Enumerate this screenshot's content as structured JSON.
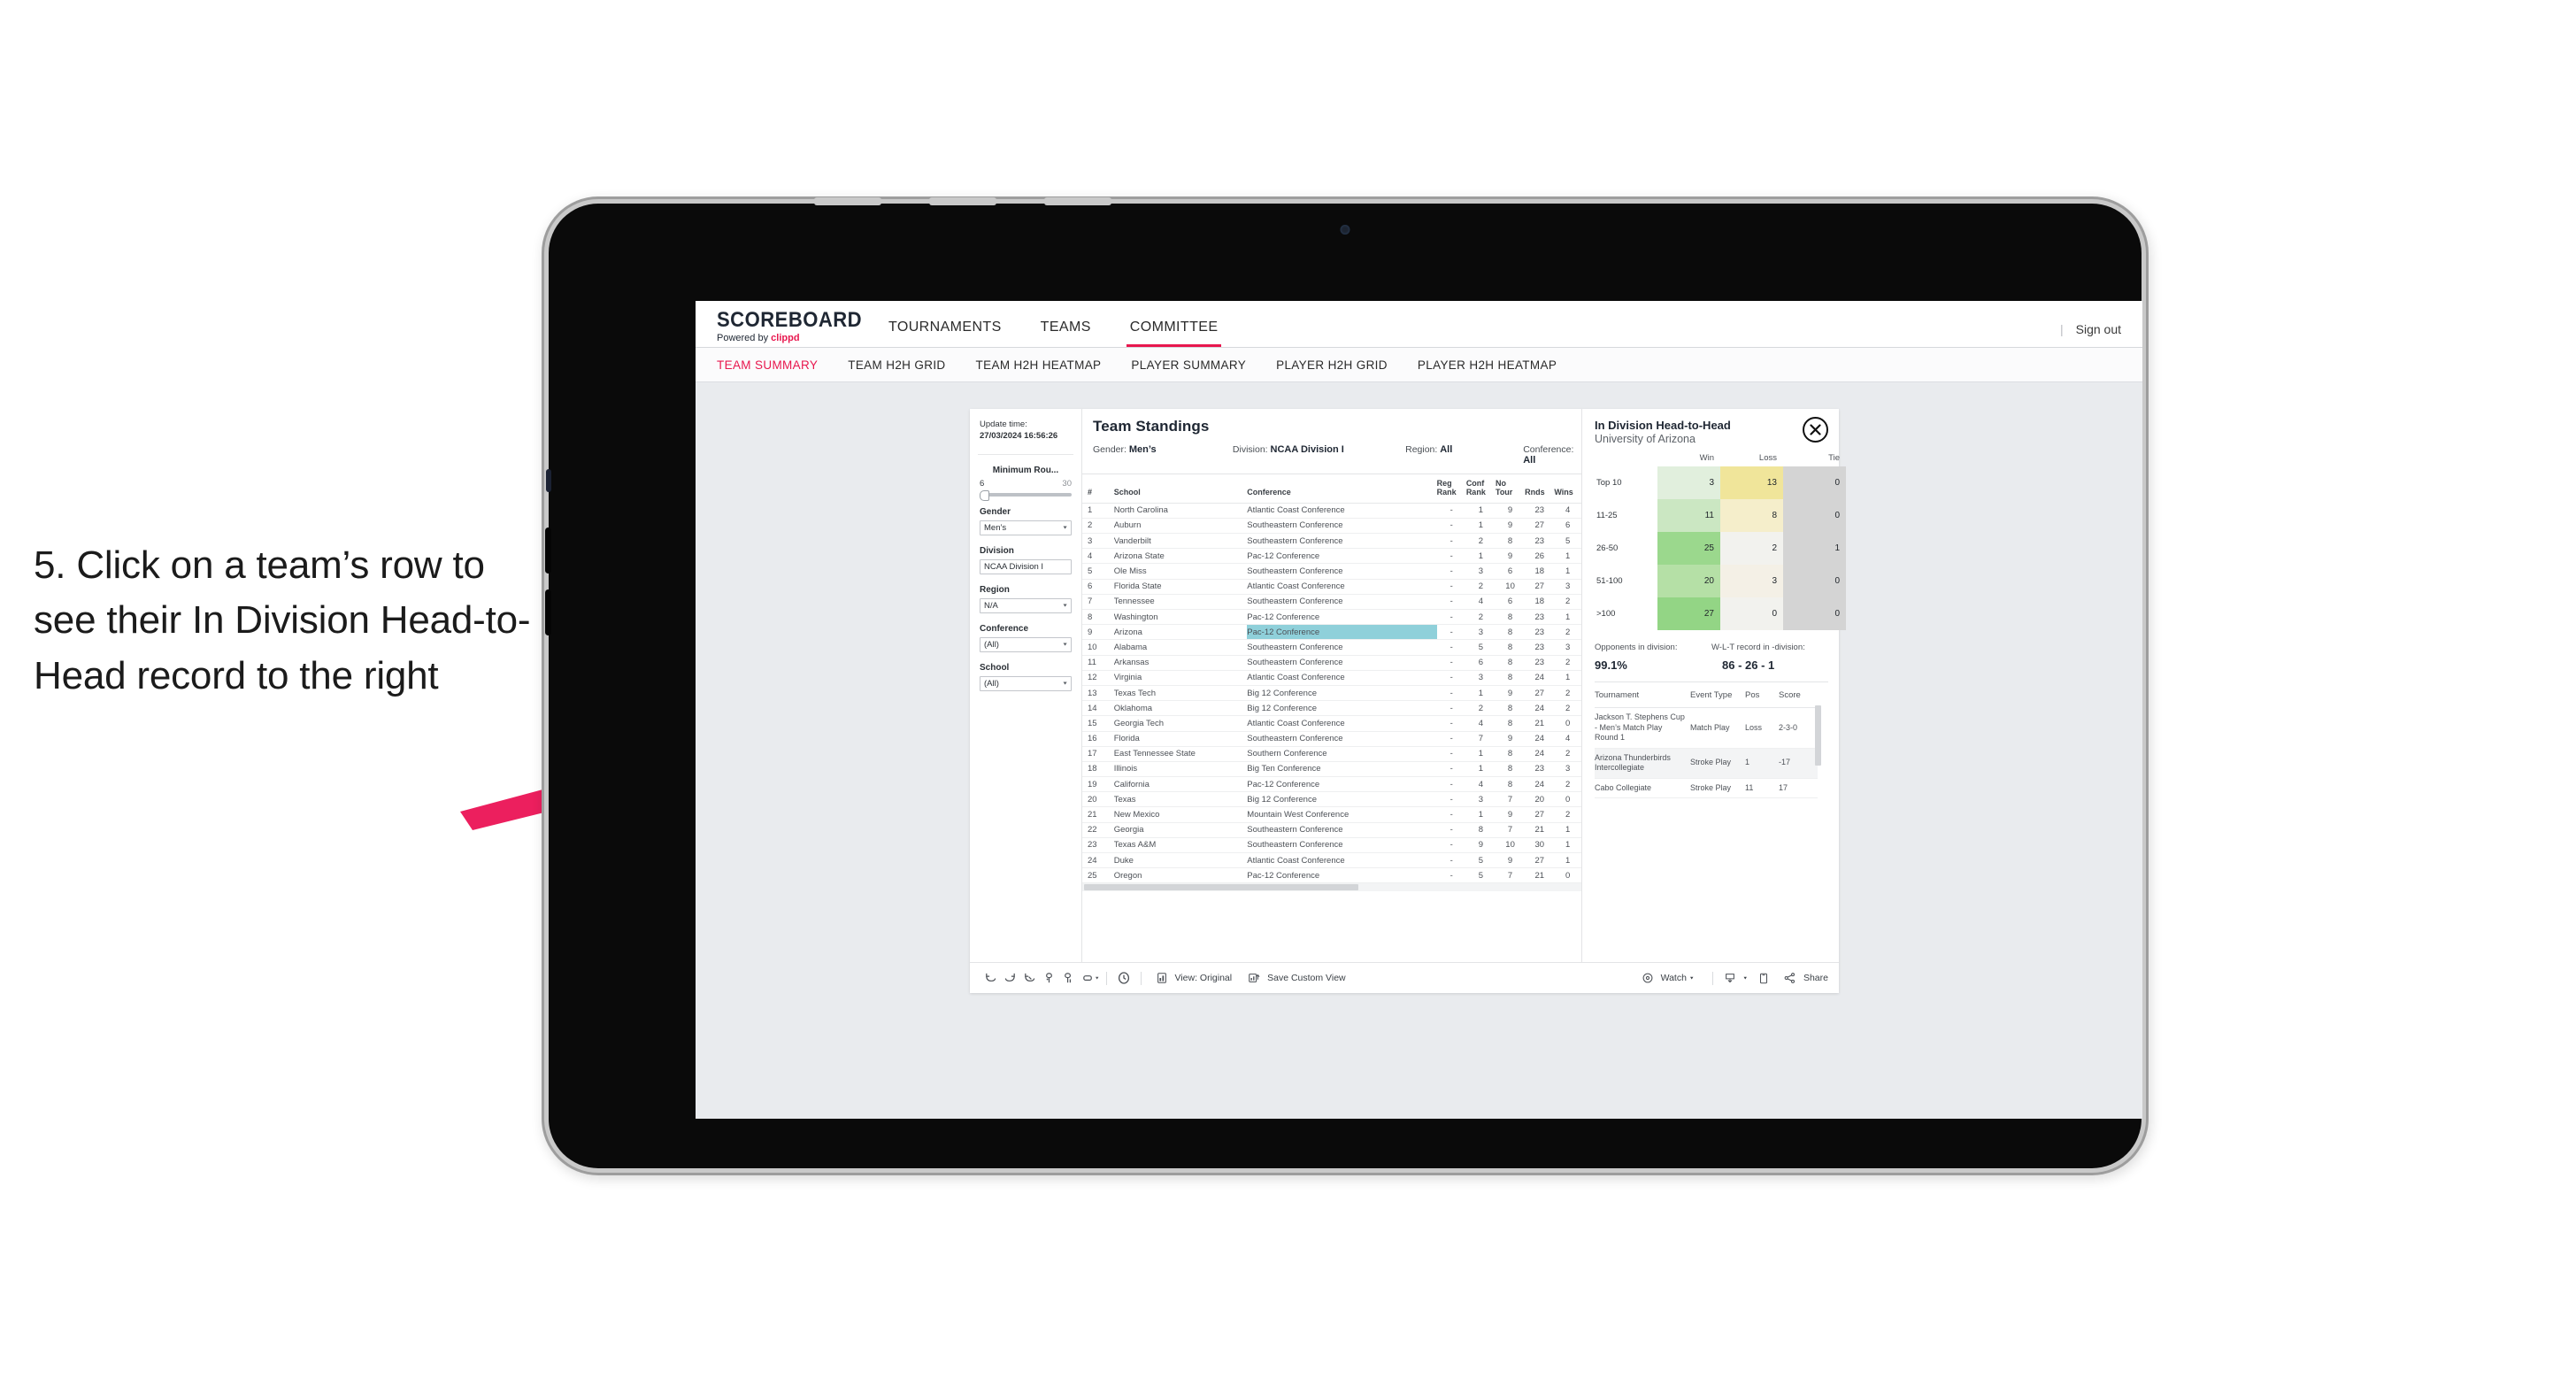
{
  "annotation": {
    "text": "5. Click on a team’s row to see their In Division Head-to-Head record to the right",
    "color": "#ec1f5e"
  },
  "app": {
    "brand": {
      "name": "SCOREBOARD",
      "powered_prefix": "Powered by ",
      "powered_brand": "clippd"
    },
    "top_nav": [
      {
        "label": "TOURNAMENTS",
        "active": false
      },
      {
        "label": "TEAMS",
        "active": false
      },
      {
        "label": "COMMITTEE",
        "active": true
      }
    ],
    "sign_out": "Sign out",
    "divider": "|",
    "sub_nav": [
      {
        "label": "TEAM SUMMARY",
        "active": true
      },
      {
        "label": "TEAM H2H GRID",
        "active": false
      },
      {
        "label": "TEAM H2H HEATMAP",
        "active": false
      },
      {
        "label": "PLAYER SUMMARY",
        "active": false
      },
      {
        "label": "PLAYER H2H GRID",
        "active": false
      },
      {
        "label": "PLAYER H2H HEATMAP",
        "active": false
      }
    ],
    "accent": "#e8174e"
  },
  "filters": {
    "update_label": "Update time:",
    "update_value": "27/03/2024 16:56:26",
    "slider": {
      "label": "Minimum Rou...",
      "min": "6",
      "max": "30"
    },
    "selects": [
      {
        "label": "Gender",
        "value": "Men’s",
        "caret": "▼"
      },
      {
        "label": "Division",
        "value": "NCAA Division I",
        "caret": "▼"
      },
      {
        "label": "Region",
        "value": "N/A",
        "caret": "▼"
      },
      {
        "label": "Conference",
        "value": "(All)",
        "caret": "▼"
      },
      {
        "label": "School",
        "value": "(All)",
        "caret": "▼"
      }
    ]
  },
  "standings": {
    "title": "Team Standings",
    "meta": [
      {
        "label": "Gender:",
        "value": "Men’s"
      },
      {
        "label": "Division:",
        "value": "NCAA Division I"
      },
      {
        "label": "Region:",
        "value": "All"
      },
      {
        "label": "Conference:",
        "value": "All"
      }
    ],
    "columns": [
      "#",
      "School",
      "Conference",
      "Reg Rank",
      "Conf Rank",
      "No Tour",
      "Rnds",
      "Wins"
    ],
    "column_labels": {
      "rank": "#",
      "school": "School",
      "conference": "Conference",
      "reg_rank_1": "Reg",
      "reg_rank_2": "Rank",
      "conf_rank_1": "Conf",
      "conf_rank_2": "Rank",
      "no_tour_1": "No",
      "no_tour_2": "Tour",
      "rnds": "Rnds",
      "wins": "Wins"
    },
    "rows": [
      {
        "rank": "1",
        "school": "North Carolina",
        "conference": "Atlantic Coast Conference",
        "reg": "-",
        "conf": "1",
        "tour": "9",
        "rnds": "23",
        "wins": "4",
        "selected": false
      },
      {
        "rank": "2",
        "school": "Auburn",
        "conference": "Southeastern Conference",
        "reg": "-",
        "conf": "1",
        "tour": "9",
        "rnds": "27",
        "wins": "6",
        "selected": false
      },
      {
        "rank": "3",
        "school": "Vanderbilt",
        "conference": "Southeastern Conference",
        "reg": "-",
        "conf": "2",
        "tour": "8",
        "rnds": "23",
        "wins": "5",
        "selected": false
      },
      {
        "rank": "4",
        "school": "Arizona State",
        "conference": "Pac-12 Conference",
        "reg": "-",
        "conf": "1",
        "tour": "9",
        "rnds": "26",
        "wins": "1",
        "selected": false
      },
      {
        "rank": "5",
        "school": "Ole Miss",
        "conference": "Southeastern Conference",
        "reg": "-",
        "conf": "3",
        "tour": "6",
        "rnds": "18",
        "wins": "1",
        "selected": false
      },
      {
        "rank": "6",
        "school": "Florida State",
        "conference": "Atlantic Coast Conference",
        "reg": "-",
        "conf": "2",
        "tour": "10",
        "rnds": "27",
        "wins": "3",
        "selected": false
      },
      {
        "rank": "7",
        "school": "Tennessee",
        "conference": "Southeastern Conference",
        "reg": "-",
        "conf": "4",
        "tour": "6",
        "rnds": "18",
        "wins": "2",
        "selected": false
      },
      {
        "rank": "8",
        "school": "Washington",
        "conference": "Pac-12 Conference",
        "reg": "-",
        "conf": "2",
        "tour": "8",
        "rnds": "23",
        "wins": "1",
        "selected": false
      },
      {
        "rank": "9",
        "school": "Arizona",
        "conference": "Pac-12 Conference",
        "reg": "-",
        "conf": "3",
        "tour": "8",
        "rnds": "23",
        "wins": "2",
        "selected": true
      },
      {
        "rank": "10",
        "school": "Alabama",
        "conference": "Southeastern Conference",
        "reg": "-",
        "conf": "5",
        "tour": "8",
        "rnds": "23",
        "wins": "3",
        "selected": false
      },
      {
        "rank": "11",
        "school": "Arkansas",
        "conference": "Southeastern Conference",
        "reg": "-",
        "conf": "6",
        "tour": "8",
        "rnds": "23",
        "wins": "2",
        "selected": false
      },
      {
        "rank": "12",
        "school": "Virginia",
        "conference": "Atlantic Coast Conference",
        "reg": "-",
        "conf": "3",
        "tour": "8",
        "rnds": "24",
        "wins": "1",
        "selected": false
      },
      {
        "rank": "13",
        "school": "Texas Tech",
        "conference": "Big 12 Conference",
        "reg": "-",
        "conf": "1",
        "tour": "9",
        "rnds": "27",
        "wins": "2",
        "selected": false
      },
      {
        "rank": "14",
        "school": "Oklahoma",
        "conference": "Big 12 Conference",
        "reg": "-",
        "conf": "2",
        "tour": "8",
        "rnds": "24",
        "wins": "2",
        "selected": false
      },
      {
        "rank": "15",
        "school": "Georgia Tech",
        "conference": "Atlantic Coast Conference",
        "reg": "-",
        "conf": "4",
        "tour": "8",
        "rnds": "21",
        "wins": "0",
        "selected": false
      },
      {
        "rank": "16",
        "school": "Florida",
        "conference": "Southeastern Conference",
        "reg": "-",
        "conf": "7",
        "tour": "9",
        "rnds": "24",
        "wins": "4",
        "selected": false
      },
      {
        "rank": "17",
        "school": "East Tennessee State",
        "conference": "Southern Conference",
        "reg": "-",
        "conf": "1",
        "tour": "8",
        "rnds": "24",
        "wins": "2",
        "selected": false
      },
      {
        "rank": "18",
        "school": "Illinois",
        "conference": "Big Ten Conference",
        "reg": "-",
        "conf": "1",
        "tour": "8",
        "rnds": "23",
        "wins": "3",
        "selected": false
      },
      {
        "rank": "19",
        "school": "California",
        "conference": "Pac-12 Conference",
        "reg": "-",
        "conf": "4",
        "tour": "8",
        "rnds": "24",
        "wins": "2",
        "selected": false
      },
      {
        "rank": "20",
        "school": "Texas",
        "conference": "Big 12 Conference",
        "reg": "-",
        "conf": "3",
        "tour": "7",
        "rnds": "20",
        "wins": "0",
        "selected": false
      },
      {
        "rank": "21",
        "school": "New Mexico",
        "conference": "Mountain West Conference",
        "reg": "-",
        "conf": "1",
        "tour": "9",
        "rnds": "27",
        "wins": "2",
        "selected": false
      },
      {
        "rank": "22",
        "school": "Georgia",
        "conference": "Southeastern Conference",
        "reg": "-",
        "conf": "8",
        "tour": "7",
        "rnds": "21",
        "wins": "1",
        "selected": false
      },
      {
        "rank": "23",
        "school": "Texas A&M",
        "conference": "Southeastern Conference",
        "reg": "-",
        "conf": "9",
        "tour": "10",
        "rnds": "30",
        "wins": "1",
        "selected": false
      },
      {
        "rank": "24",
        "school": "Duke",
        "conference": "Atlantic Coast Conference",
        "reg": "-",
        "conf": "5",
        "tour": "9",
        "rnds": "27",
        "wins": "1",
        "selected": false
      },
      {
        "rank": "25",
        "school": "Oregon",
        "conference": "Pac-12 Conference",
        "reg": "-",
        "conf": "5",
        "tour": "7",
        "rnds": "21",
        "wins": "0",
        "selected": false
      }
    ],
    "highlight_color": "#8fd0da"
  },
  "h2h": {
    "title": "In Division Head-to-Head",
    "subtitle": "University of Arizona",
    "close_label": "✕",
    "columns": [
      "Win",
      "Loss",
      "Tie"
    ],
    "rows": [
      {
        "label": "Top 10",
        "win": "3",
        "loss": "13",
        "tie": "0",
        "win_color": "#e1efdd",
        "loss_color": "#f0e59a",
        "tie_color": "#d4d4d4"
      },
      {
        "label": "11-25",
        "win": "11",
        "loss": "8",
        "tie": "0",
        "win_color": "#cbe7c2",
        "loss_color": "#f5eecb",
        "tie_color": "#d4d4d4"
      },
      {
        "label": "26-50",
        "win": "25",
        "loss": "2",
        "tie": "1",
        "win_color": "#9bd88d",
        "loss_color": "#f2f2ee",
        "tie_color": "#d4d4d4"
      },
      {
        "label": "51-100",
        "win": "20",
        "loss": "3",
        "tie": "0",
        "win_color": "#b5e0a6",
        "loss_color": "#f4f0e6",
        "tie_color": "#d4d4d4"
      },
      {
        "label": ">100",
        "win": "27",
        "loss": "0",
        "tie": "0",
        "win_color": "#93d585",
        "loss_color": "#f2f2ee",
        "tie_color": "#d4d4d4"
      }
    ],
    "stats": [
      {
        "caption": "Opponents in division:",
        "value": "99.1%"
      },
      {
        "caption": "W-L-T record in -division:",
        "value": "86 - 26 - 1"
      }
    ],
    "tournaments": {
      "columns": [
        "Tournament",
        "Event Type",
        "Pos",
        "Score"
      ],
      "rows": [
        {
          "name": "Jackson T. Stephens Cup - Men’s Match Play Round 1",
          "type": "Match Play",
          "pos": "Loss",
          "score": "2-3-0"
        },
        {
          "name": "Arizona Thunderbirds Intercollegiate",
          "type": "Stroke Play",
          "pos": "1",
          "score": "-17"
        },
        {
          "name": "Cabo Collegiate",
          "type": "Stroke Play",
          "pos": "11",
          "score": "17"
        }
      ]
    }
  },
  "toolbar": {
    "view_label": "View: Original",
    "save_label": "Save Custom View",
    "watch_label": "Watch",
    "share_label": "Share",
    "caret": "▾"
  }
}
